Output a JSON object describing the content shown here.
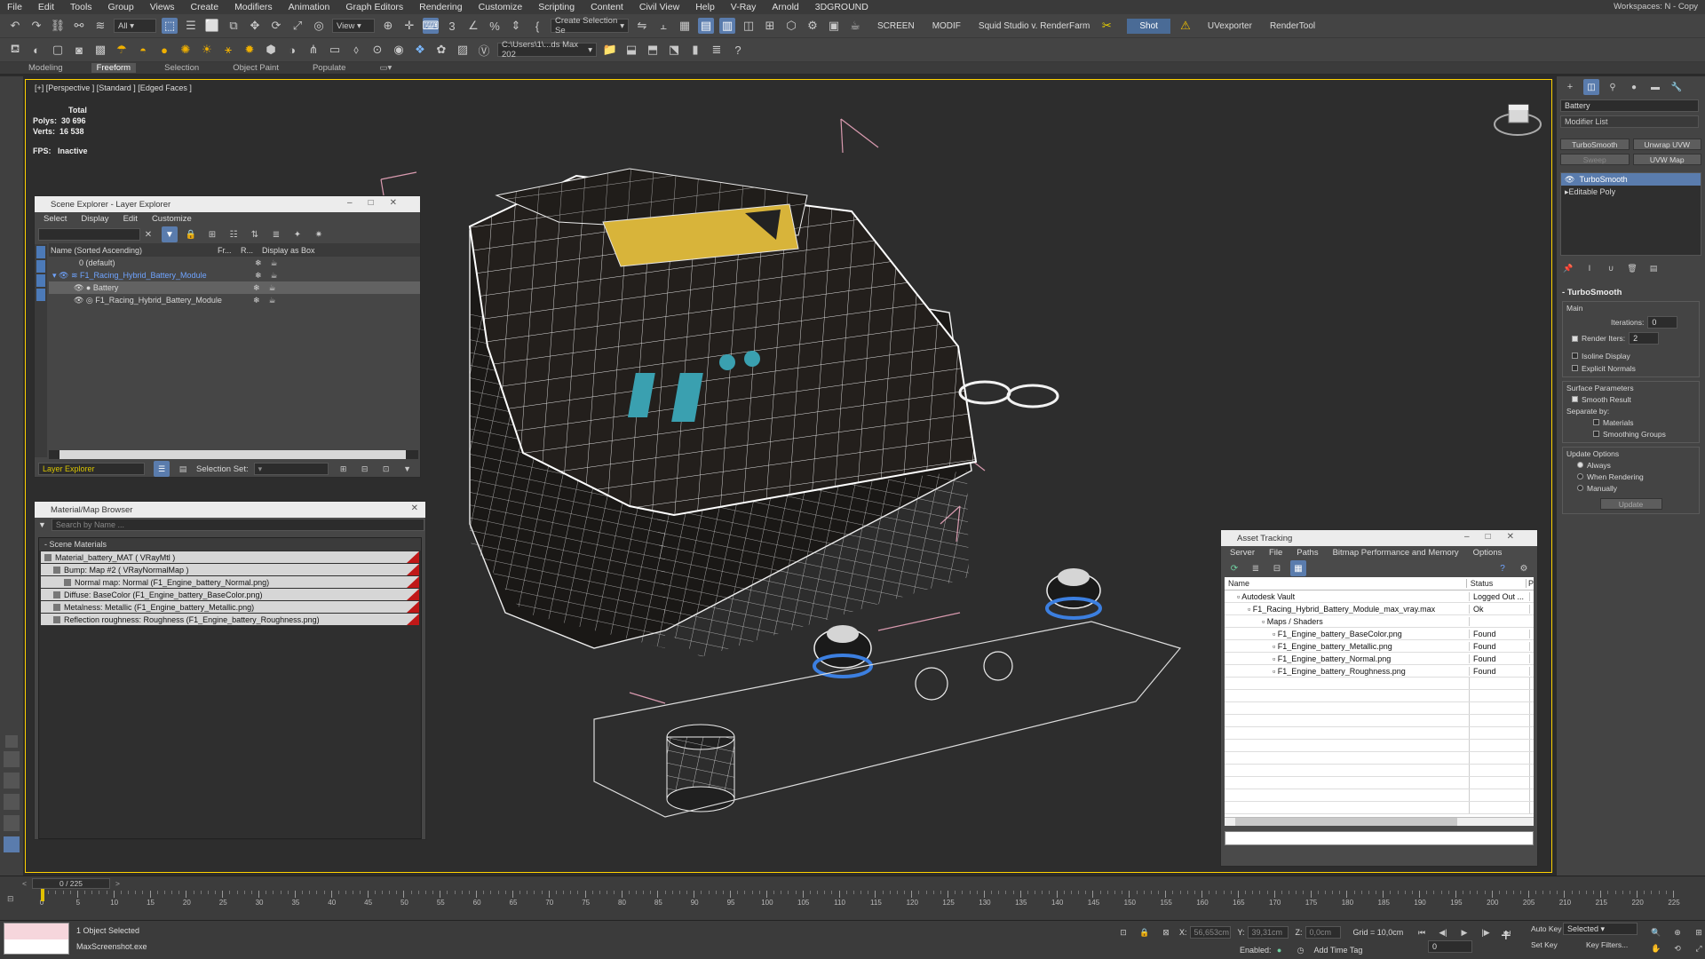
{
  "menubar": {
    "items": [
      "File",
      "Edit",
      "Tools",
      "Group",
      "Views",
      "Create",
      "Modifiers",
      "Animation",
      "Graph Editors",
      "Rendering",
      "Customize",
      "Scripting",
      "Content",
      "Civil View",
      "Help",
      "V-Ray",
      "Arnold",
      "3DGROUND"
    ],
    "workspaces_label": "Workspaces:",
    "workspaces_value": "N - Copy"
  },
  "toolbar1": {
    "filter_all": "All",
    "view_mode": "View",
    "selection_set": "Create Selection Se",
    "screen_label": "SCREEN",
    "modif_label": "MODIF",
    "plugin_label": "Squid Studio v. RenderFarm",
    "shot_button": "Shot",
    "uvexporter": "UVexporter",
    "rendertool": "RenderTool"
  },
  "toolbar2": {
    "path_dropdown": "C:\\Users\\1\\...ds Max 202"
  },
  "ribbon": {
    "tabs": [
      "Modeling",
      "Freeform",
      "Selection",
      "Object Paint",
      "Populate"
    ],
    "active_tab": "Freeform"
  },
  "viewport": {
    "label": "[+] [Perspective ] [Standard ] [Edged Faces ]",
    "stats_title": "Total",
    "polys_label": "Polys:",
    "polys_value": "30 696",
    "verts_label": "Verts:",
    "verts_value": "16 538",
    "fps_label": "FPS:",
    "fps_value": "Inactive"
  },
  "scene_explorer": {
    "title": "Scene Explorer - Layer Explorer",
    "menu": [
      "Select",
      "Display",
      "Edit",
      "Customize"
    ],
    "col_name": "Name (Sorted Ascending)",
    "col_fr": "Fr...",
    "col_r": "R...",
    "col_display": "Display as Box",
    "rows": [
      "0 (default)",
      "F1_Racing_Hybrid_Battery_Module",
      "Battery",
      "F1_Racing_Hybrid_Battery_Module"
    ],
    "footer_layer": "Layer Explorer",
    "footer_selset": "Selection Set:"
  },
  "material_browser": {
    "title": "Material/Map Browser",
    "search_placeholder": "Search by Name ...",
    "section": "- Scene Materials",
    "rows": [
      "Material_battery_MAT ( VRayMtl )",
      "Bump: Map #2 ( VRayNormalMap )",
      "Normal map: Normal (F1_Engine_battery_Normal.png)",
      "Diffuse: BaseColor (F1_Engine_battery_BaseColor.png)",
      "Metalness: Metallic (F1_Engine_battery_Metallic.png)",
      "Reflection roughness: Roughness (F1_Engine_battery_Roughness.png)"
    ]
  },
  "asset_tracking": {
    "title": "Asset Tracking",
    "menu": [
      "Server",
      "File",
      "Paths",
      "Bitmap Performance and Memory",
      "Options"
    ],
    "col_name": "Name",
    "col_status": "Status",
    "col_p": "P",
    "rows": [
      {
        "name": "Autodesk Vault",
        "status": "Logged Out ..."
      },
      {
        "name": "F1_Racing_Hybrid_Battery_Module_max_vray.max",
        "status": "Ok"
      },
      {
        "name": "Maps / Shaders",
        "status": ""
      },
      {
        "name": "F1_Engine_battery_BaseColor.png",
        "status": "Found"
      },
      {
        "name": "F1_Engine_battery_Metallic.png",
        "status": "Found"
      },
      {
        "name": "F1_Engine_battery_Normal.png",
        "status": "Found"
      },
      {
        "name": "F1_Engine_battery_Roughness.png",
        "status": "Found"
      }
    ]
  },
  "command_panel": {
    "object_name": "Battery",
    "modifier_list": "Modifier List",
    "btn_turbosmooth": "TurboSmooth",
    "btn_unwrap": "Unwrap UVW",
    "btn_sweep": "Sweep",
    "btn_uvwmap": "UVW Map",
    "stack": [
      "TurboSmooth",
      "Editable Poly"
    ],
    "rollout_title": "TurboSmooth",
    "main_label": "Main",
    "iterations_label": "Iterations:",
    "iterations_value": "0",
    "render_iters_label": "Render Iters:",
    "render_iters_value": "2",
    "isoline": "Isoline Display",
    "explicit_normals": "Explicit Normals",
    "surface_params": "Surface Parameters",
    "smooth_result": "Smooth Result",
    "separate_by": "Separate by:",
    "materials": "Materials",
    "smoothing_groups": "Smoothing Groups",
    "update_options": "Update Options",
    "always": "Always",
    "when_rendering": "When Rendering",
    "manually": "Manually",
    "update_btn": "Update"
  },
  "timeline": {
    "frame_counter": "0 / 225",
    "ticks": [
      "0",
      "5",
      "10",
      "15",
      "20",
      "25",
      "30",
      "35",
      "40",
      "45",
      "50",
      "55",
      "60",
      "65",
      "70",
      "75",
      "80",
      "85",
      "90",
      "95",
      "100",
      "105",
      "110",
      "115",
      "120",
      "125",
      "130",
      "135",
      "140",
      "145",
      "150",
      "155",
      "160",
      "165",
      "170",
      "175",
      "180",
      "185",
      "190",
      "195",
      "200",
      "205",
      "210",
      "215",
      "220",
      "225"
    ]
  },
  "statusbar": {
    "selected": "1 Object Selected",
    "script_file": "MaxScreenshot.exe",
    "x_label": "X:",
    "x_value": "56,653cm",
    "y_label": "Y:",
    "y_value": "39,31cm",
    "z_label": "Z:",
    "z_value": "0,0cm",
    "grid": "Grid = 10,0cm",
    "enabled": "Enabled:",
    "add_time_tag": "Add Time Tag",
    "autokey": "Auto Key",
    "setkey": "Set Key",
    "selected_dropdown": "Selected",
    "key_filters": "Key Filters...",
    "frame_value": "0"
  }
}
